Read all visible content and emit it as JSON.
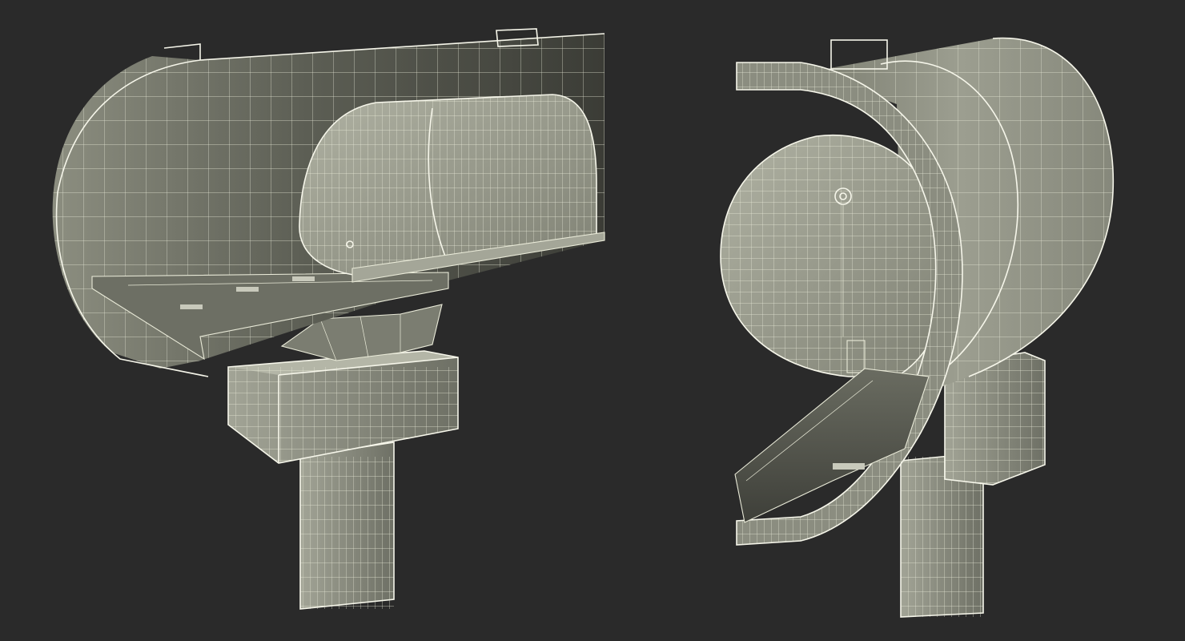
{
  "scene": {
    "background_color": "#2a2a2a",
    "surface_color": "#8f9183",
    "surface_shadow_color": "#4a4b44",
    "wire_color": "#e9ead8",
    "description_label": ""
  },
  "views": [
    {
      "id": "front",
      "content": "3d-wireframe-render"
    },
    {
      "id": "back",
      "content": "3d-wireframe-render"
    }
  ]
}
